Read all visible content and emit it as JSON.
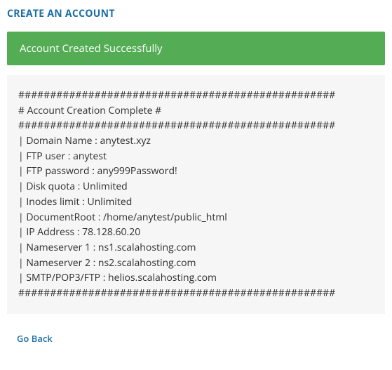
{
  "header": {
    "title": "CREATE AN ACCOUNT"
  },
  "alert": {
    "message": "Account Created Successfully"
  },
  "output": {
    "separator_top": "##################################################",
    "heading": "# Account Creation Complete #",
    "separator_mid": "##################################################",
    "fields": {
      "domain_name": "anytest.xyz",
      "ftp_user": "anytest",
      "ftp_password": "any999Password!",
      "disk_quota": "Unlimited",
      "inodes_limit": "Unlimited",
      "document_root": "/home/anytest/public_html",
      "ip_address": "78.128.60.20",
      "nameserver_1": "ns1.scalahosting.com",
      "nameserver_2": "ns2.scalahosting.com",
      "smtp_pop3_ftp": "helios.scalahosting.com"
    },
    "separator_bottom": "##################################################",
    "lines": [
      "##################################################",
      "# Account Creation Complete #",
      "##################################################",
      "| Domain Name : anytest.xyz",
      "| FTP user : anytest",
      "| FTP password : any999Password!",
      "| Disk quota : Unlimited",
      "| Inodes limit : Unlimited",
      "| DocumentRoot : /home/anytest/public_html",
      "| IP Address : 78.128.60.20",
      "| Nameserver 1 : ns1.scalahosting.com",
      "| Nameserver 2 : ns2.scalahosting.com",
      "| SMTP/POP3/FTP : helios.scalahosting.com",
      "##################################################"
    ]
  },
  "nav": {
    "go_back_label": "Go Back"
  }
}
